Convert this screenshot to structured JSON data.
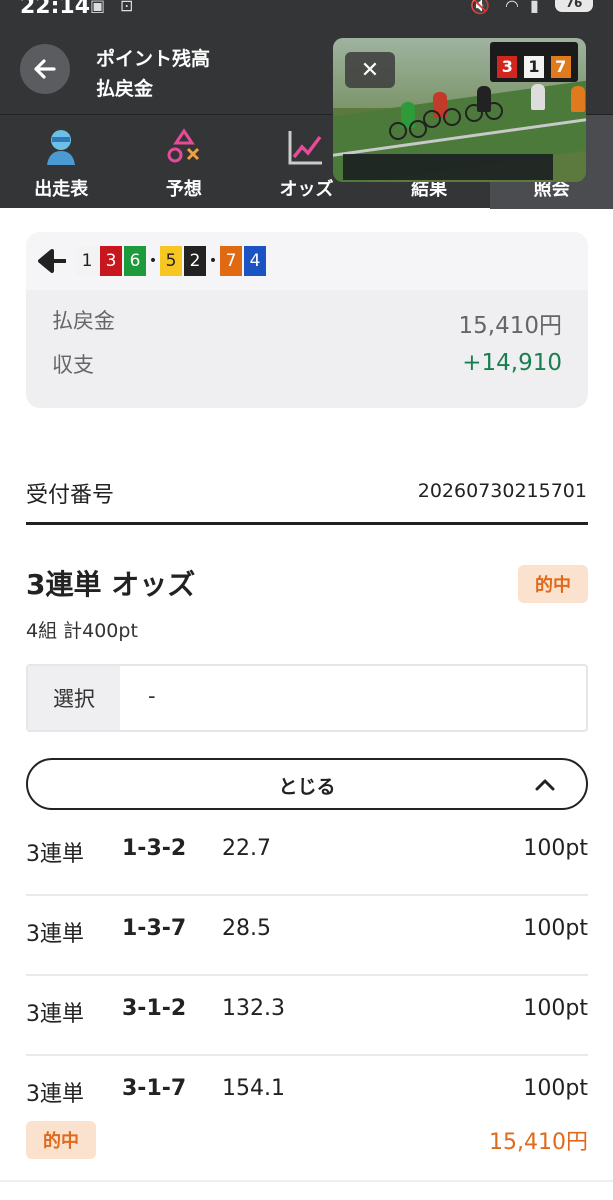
{
  "status_bar": {
    "time": "22:14",
    "battery": "76"
  },
  "header": {
    "title_line1": "ポイント残高",
    "title_line2": "払戻金"
  },
  "tabs": [
    {
      "label": "出走表",
      "icon": "person-icon",
      "active": false
    },
    {
      "label": "予想",
      "icon": "shapes-icon",
      "active": false
    },
    {
      "label": "オッズ",
      "icon": "chart-icon",
      "active": false
    },
    {
      "label": "結果",
      "icon": "result-icon",
      "active": false
    },
    {
      "label": "照会",
      "icon": "inquiry-icon",
      "active": true
    }
  ],
  "video": {
    "close_label": "✕",
    "score": [
      "3",
      "1",
      "7"
    ],
    "score_colors": [
      "#d0261f",
      "#f3f3f3",
      "#e07a1e"
    ]
  },
  "combo": {
    "items": [
      {
        "num": "1",
        "bg": "#f3f3f3",
        "fg": "#222"
      },
      {
        "num": "3",
        "bg": "#c8161e",
        "fg": "#fff"
      },
      {
        "num": "6",
        "bg": "#1d9a3c",
        "fg": "#fff"
      },
      {
        "sep": "•"
      },
      {
        "num": "5",
        "bg": "#f6c623",
        "fg": "#222"
      },
      {
        "num": "2",
        "bg": "#222222",
        "fg": "#fff"
      },
      {
        "sep": "•"
      },
      {
        "num": "7",
        "bg": "#e06a12",
        "fg": "#fff"
      },
      {
        "num": "4",
        "bg": "#1b54c2",
        "fg": "#fff"
      }
    ]
  },
  "summary": {
    "payout_label": "払戻金",
    "payout_value": "15,410円",
    "balance_label": "収支",
    "balance_value": "+14,910",
    "balance_color": "#1a7f4f"
  },
  "receipt": {
    "label": "受付番号",
    "value": "20260730215701"
  },
  "bet": {
    "title": "3連単 オッズ",
    "hit_label": "的中",
    "summary": "4組 計400pt",
    "select_label": "選択",
    "select_value": "-",
    "close_label": "とじる",
    "accent_color": "#e06a1b"
  },
  "bets": [
    {
      "type": "3連単",
      "combo": "1-3-2",
      "odds": "22.7",
      "amount": "100pt"
    },
    {
      "type": "3連単",
      "combo": "1-3-7",
      "odds": "28.5",
      "amount": "100pt"
    },
    {
      "type": "3連単",
      "combo": "3-1-2",
      "odds": "132.3",
      "amount": "100pt"
    },
    {
      "type": "3連単",
      "combo": "3-1-7",
      "odds": "154.1",
      "amount": "100pt",
      "hit": "的中",
      "payout": "15,410円"
    }
  ]
}
